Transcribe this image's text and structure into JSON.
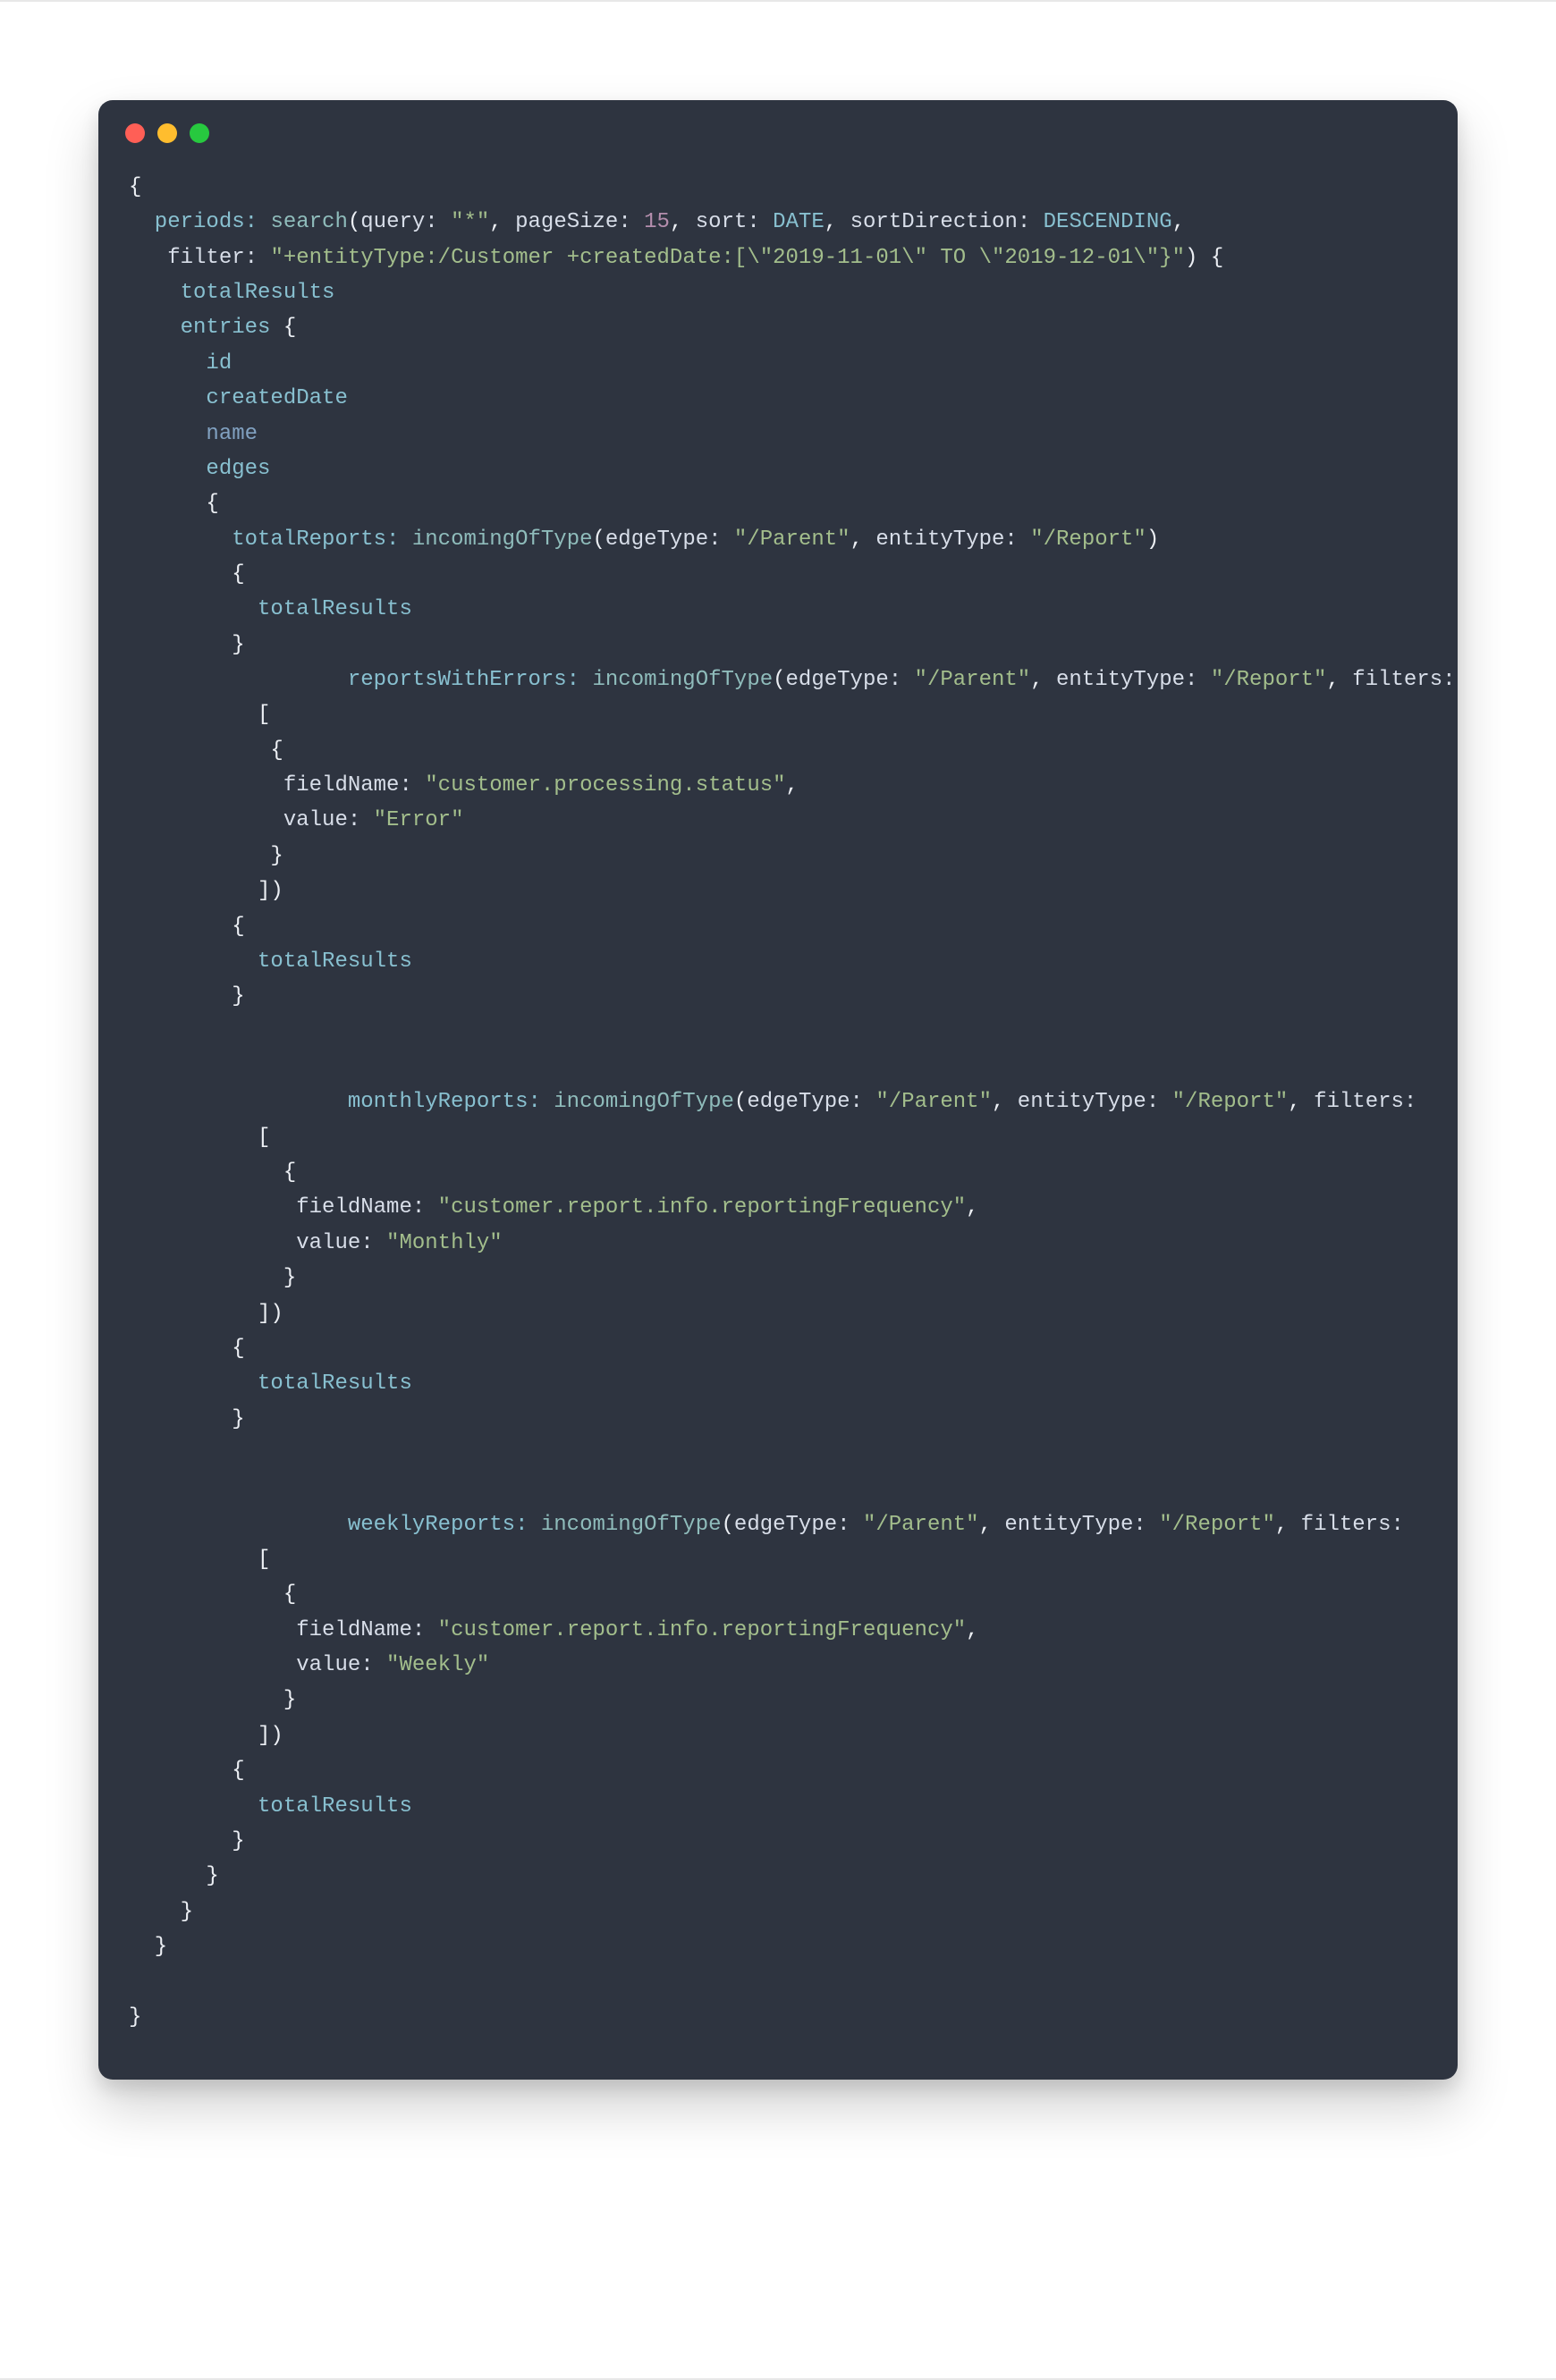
{
  "titlebar": {
    "red": "close",
    "yellow": "minimize",
    "green": "zoom"
  },
  "code": {
    "l1a": "{",
    "l2a": "  periods: ",
    "l2b": "search",
    "l2c": "(",
    "l2d": "query:",
    "l2e": " \"*\"",
    "l2f": ", ",
    "l2g": "pageSize:",
    "l2h": " 15",
    "l2i": ", ",
    "l2j": "sort:",
    "l2k": " DATE",
    "l2l": ", ",
    "l2m": "sortDirection:",
    "l2n": " DESCENDING",
    "l2o": ",",
    "l3a": "   ",
    "l3b": "filter:",
    "l3c": " \"+entityType:/Customer +createdDate:[\\\"2019-11-01\\\" TO \\\"2019-12-01\\\"}\"",
    "l3d": ")",
    "l3e": " {",
    "l4a": "    totalResults",
    "l5a": "    entries ",
    "l5b": "{",
    "l6a": "      id",
    "l7a": "      createdDate",
    "l8a": "      name",
    "l9a": "      edges ",
    "l10a": "      {",
    "l11a": "        totalReports: ",
    "l11b": "incomingOfType",
    "l11c": "(",
    "l11d": "edgeType:",
    "l11e": " \"/Parent\"",
    "l11f": ", ",
    "l11g": "entityType:",
    "l11h": " \"/Report\"",
    "l11i": ")",
    "l12a": "        {",
    "l13a": "          totalResults",
    "l14a": "        }",
    "l15a": "                 reportsWithErrors: ",
    "l15b": "incomingOfType",
    "l15c": "(",
    "l15d": "edgeType:",
    "l15e": " \"/Parent\"",
    "l15f": ", ",
    "l15g": "entityType:",
    "l15h": " \"/Report\"",
    "l15i": ", ",
    "l15j": "filters:",
    "l16a": "          [",
    "l17a": "           {",
    "l18a": "            ",
    "l18b": "fieldName:",
    "l18c": " \"customer.processing.status\"",
    "l18d": ",",
    "l19a": "            ",
    "l19b": "value:",
    "l19c": " \"Error\"",
    "l20a": "           }",
    "l21a": "          ])",
    "l22a": "        {",
    "l23a": "          totalResults",
    "l24a": "        }",
    "blank": "",
    "l25a": "                 monthlyReports: ",
    "l25b": "incomingOfType",
    "l25c": "(",
    "l25d": "edgeType:",
    "l25e": " \"/Parent\"",
    "l25f": ", ",
    "l25g": "entityType:",
    "l25h": " \"/Report\"",
    "l25i": ", ",
    "l25j": "filters:",
    "l26a": "          [",
    "l27a": "            {",
    "l28a": "             ",
    "l28b": "fieldName:",
    "l28c": " \"customer.report.info.reportingFrequency\"",
    "l28d": ",",
    "l29a": "             ",
    "l29b": "value:",
    "l29c": " \"Monthly\"",
    "l30a": "            }",
    "l31a": "          ])",
    "l32a": "        {",
    "l33a": "          totalResults",
    "l34a": "        }",
    "l35a": "                 weeklyReports: ",
    "l35b": "incomingOfType",
    "l35c": "(",
    "l35d": "edgeType:",
    "l35e": " \"/Parent\"",
    "l35f": ", ",
    "l35g": "entityType:",
    "l35h": " \"/Report\"",
    "l35i": ", ",
    "l35j": "filters:",
    "l36a": "          [",
    "l37a": "            {",
    "l38a": "             ",
    "l38b": "fieldName:",
    "l38c": " \"customer.report.info.reportingFrequency\"",
    "l38d": ",",
    "l39a": "             ",
    "l39b": "value:",
    "l39c": " \"Weekly\"",
    "l40a": "            }",
    "l41a": "          ])",
    "l42a": "        {",
    "l43a": "          totalResults",
    "l44a": "        }",
    "l45a": "      }",
    "l46a": "    }",
    "l47a": "  }",
    "l48a": "}"
  }
}
